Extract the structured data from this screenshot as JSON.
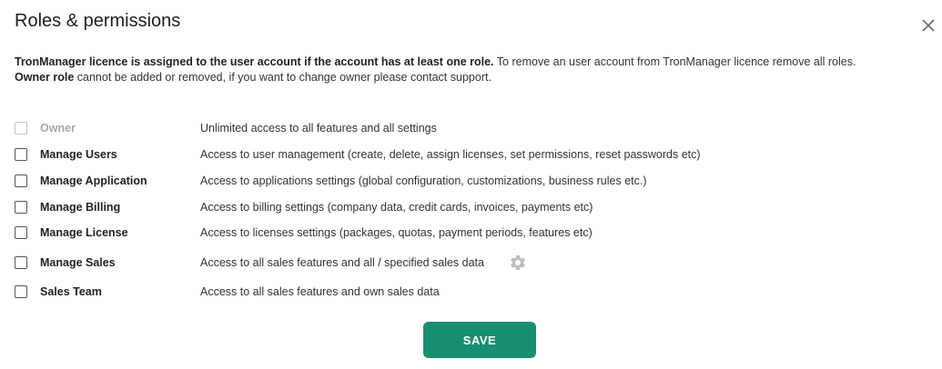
{
  "dialog": {
    "title": "Roles & permissions"
  },
  "info": {
    "line1_bold": "TronManager licence is assigned to the user account if the account has at least one role.",
    "line1_rest": " To remove an user account from TronManager licence remove all roles.",
    "line2_bold": "Owner role",
    "line2_rest": " cannot be added or removed, if you want to change owner please contact support."
  },
  "roles": [
    {
      "name": "Owner",
      "description": "Unlimited access to all features and all settings",
      "checked": false,
      "disabled": true
    },
    {
      "name": "Manage Users",
      "description": "Access to user management (create, delete, assign licenses, set permissions, reset passwords etc)",
      "checked": false,
      "disabled": false
    },
    {
      "name": "Manage Application",
      "description": "Access to applications settings (global configuration, customizations, business rules etc.)",
      "checked": false,
      "disabled": false
    },
    {
      "name": "Manage Billing",
      "description": "Access to billing settings (company data, credit cards, invoices, payments etc)",
      "checked": false,
      "disabled": false
    },
    {
      "name": "Manage License",
      "description": "Access to licenses settings (packages, quotas, payment periods, features etc)",
      "checked": false,
      "disabled": false
    },
    {
      "name": "Manage Sales",
      "description": "Access to all sales features and all / specified sales data",
      "checked": false,
      "disabled": false,
      "settings_icon": "gear-icon"
    },
    {
      "name": "Sales Team",
      "description": "Access to all sales features and own sales data",
      "checked": false,
      "disabled": false
    }
  ],
  "actions": {
    "save_label": "SAVE"
  },
  "colors": {
    "accent": "#178f70",
    "disabled": "#a8a8a8"
  }
}
